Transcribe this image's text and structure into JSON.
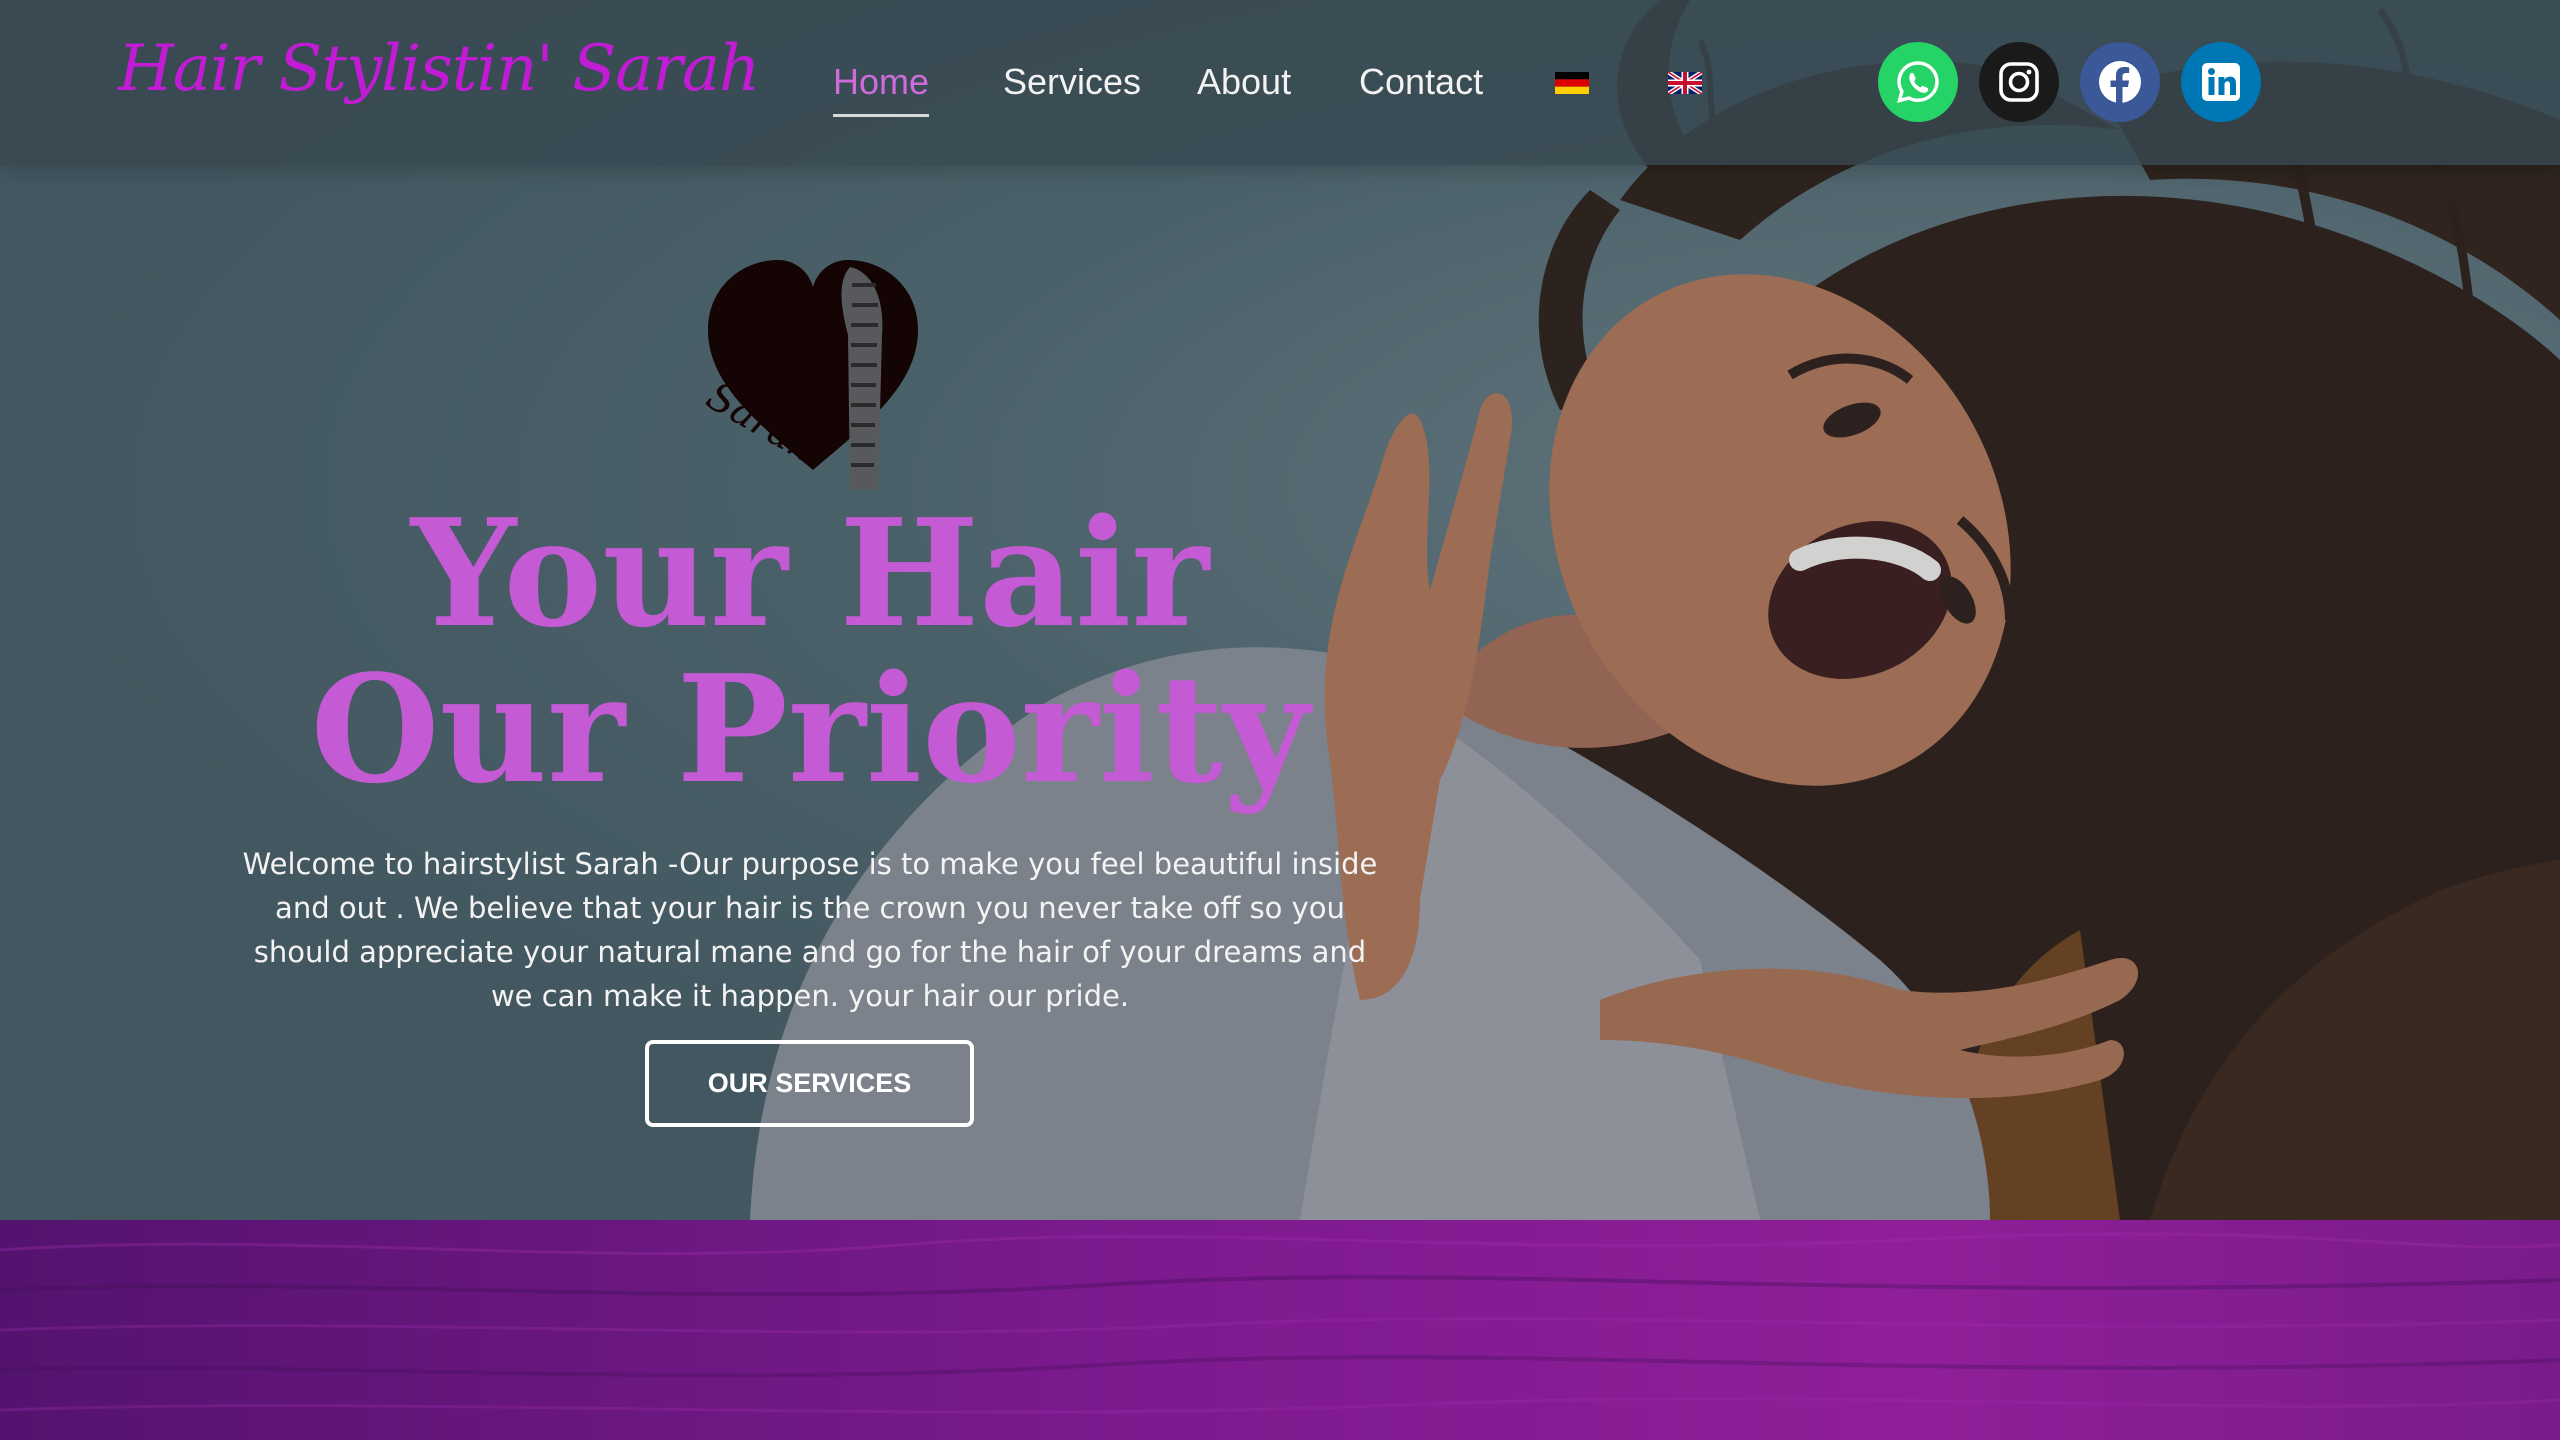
{
  "header": {
    "brand": "Hair Stylistin' Sarah",
    "nav": [
      {
        "label": "Home",
        "active": true
      },
      {
        "label": "Services",
        "active": false
      },
      {
        "label": "About",
        "active": false
      },
      {
        "label": "Contact",
        "active": false
      }
    ],
    "languages": [
      {
        "name": "german-flag-icon"
      },
      {
        "name": "uk-flag-icon"
      }
    ],
    "social": [
      {
        "name": "whatsapp-icon",
        "color": "#25d366"
      },
      {
        "name": "instagram-icon",
        "color": "#1a1a1a"
      },
      {
        "name": "facebook-icon",
        "color": "#3b5998"
      },
      {
        "name": "linkedin-icon",
        "color": "#0077b5"
      }
    ]
  },
  "hero": {
    "logo_text": "Sarah",
    "headline_line1": "Your Hair",
    "headline_line2": "Our Priority",
    "intro": "Welcome to hairstylist Sarah -Our  purpose is to make you feel beautiful inside and out . We believe that your hair is the crown you never take off so you should appreciate your natural mane and go for the hair of your dreams and we can make it happen. your hair our pride.",
    "cta_label": "OUR SERVICES"
  },
  "colors": {
    "brand": "#c21bd6",
    "headline": "#c45ad4",
    "nav_active": "#d06bdb",
    "purple_section": "#7d1a8f"
  }
}
